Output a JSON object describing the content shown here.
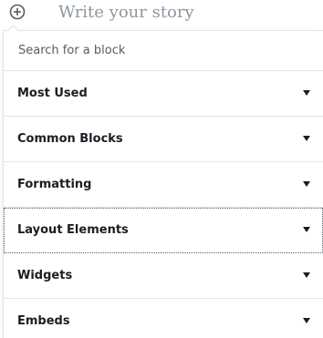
{
  "editor": {
    "placeholder": "Write your story",
    "add_icon": "plus-circle-icon"
  },
  "inserter": {
    "search_placeholder": "Search for a block",
    "panels": [
      {
        "label": "Most Used",
        "icon": "triangle-down-icon"
      },
      {
        "label": "Common Blocks",
        "icon": "triangle-down-icon"
      },
      {
        "label": "Formatting",
        "icon": "triangle-down-icon"
      },
      {
        "label": "Layout Elements",
        "icon": "triangle-down-icon",
        "focused": true
      },
      {
        "label": "Widgets",
        "icon": "triangle-down-icon"
      },
      {
        "label": "Embeds",
        "icon": "triangle-down-icon"
      }
    ]
  },
  "colors": {
    "text": "#191e23",
    "muted": "#8d96a0",
    "border": "#e2e4e7"
  }
}
